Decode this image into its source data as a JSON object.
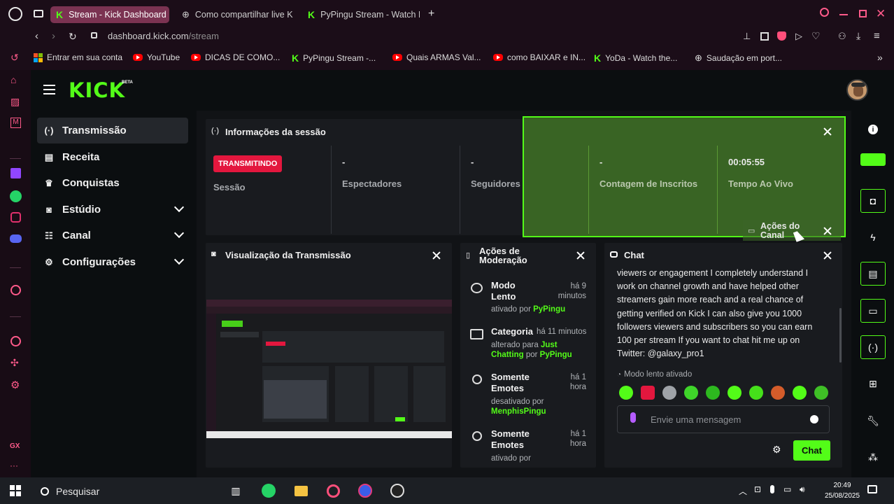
{
  "browser": {
    "tabs": [
      {
        "label": "Stream - Kick Dashboard",
        "active": true
      },
      {
        "label": "Como compartilhar live K",
        "active": false
      },
      {
        "label": "PyPingu Stream - Watch L",
        "active": false
      }
    ],
    "address_host": "dashboard.kick.com",
    "address_path": "/stream",
    "bookmarks": [
      {
        "label": "Entrar em sua conta"
      },
      {
        "label": "YouTube"
      },
      {
        "label": "DICAS DE COMO..."
      },
      {
        "label": "PyPingu Stream -..."
      },
      {
        "label": "Quais ARMAS Val..."
      },
      {
        "label": "como BAIXAR e IN..."
      },
      {
        "label": "YoDa - Watch the..."
      },
      {
        "label": "Saudação em port..."
      }
    ],
    "gx_label": "GX"
  },
  "kick": {
    "logo": "KICK",
    "logo_badge": "BETA"
  },
  "nav": [
    {
      "label": "Transmissão",
      "icon": "broadcast-icon",
      "active": true,
      "expandable": false
    },
    {
      "label": "Receita",
      "icon": "chart-icon",
      "active": false,
      "expandable": false
    },
    {
      "label": "Conquistas",
      "icon": "trophy-icon",
      "active": false,
      "expandable": false
    },
    {
      "label": "Estúdio",
      "icon": "studio-icon",
      "active": false,
      "expandable": true
    },
    {
      "label": "Canal",
      "icon": "users-icon",
      "active": false,
      "expandable": true
    },
    {
      "label": "Configurações",
      "icon": "gear-icon",
      "active": false,
      "expandable": true
    }
  ],
  "session": {
    "title": "Informações da sessão",
    "status_badge": "TRANSMITINDO",
    "stats": [
      {
        "value": "",
        "label": "Sessão"
      },
      {
        "value": "-",
        "label": "Espectadores"
      },
      {
        "value": "-",
        "label": "Seguidores"
      },
      {
        "value": "-",
        "label": "Contagem de Inscritos"
      },
      {
        "value": "00:05:55",
        "label": "Tempo Ao Vivo"
      }
    ]
  },
  "channel_actions": {
    "title_line1": "Ações do",
    "title_line2": "Canal"
  },
  "preview": {
    "title": "Visualização da Transmissão"
  },
  "moderation": {
    "title_line1": "Ações de",
    "title_line2": "Moderação",
    "entries": [
      {
        "title1": "Modo",
        "title2": "Lento",
        "time1": "há 9",
        "time2": "minutos",
        "action": "ativado por",
        "user": "PyPingu"
      },
      {
        "title1": "Categoria",
        "time_inline": "há 11 minutos",
        "action": "alterado para",
        "value1": "Just",
        "value2": "Chatting",
        "by": "por",
        "user": "PyPingu"
      },
      {
        "title1": "Somente",
        "title2": "Emotes",
        "time1": "há 1",
        "time2": "hora",
        "action": "desativado por",
        "user": "MenphisPingu"
      },
      {
        "title1": "Somente",
        "title2": "Emotes",
        "time1": "há 1",
        "time2": "hora",
        "action": "ativado por"
      }
    ]
  },
  "chat": {
    "title": "Chat",
    "message_lines": [
      "viewers or engagement I completely understand I",
      "work on channel growth and have helped other",
      "streamers gain more reach and a real chance of",
      "getting verified on Kick I can also give you 1000",
      "followers viewers and subscribers so you can earn",
      "100 per stream If you want to chat hit me up on",
      "Twitter: @galaxy_pro1"
    ],
    "slow_mode_notice": "Modo lento ativado",
    "input_placeholder": "Envie uma mensagem",
    "send_label": "Chat"
  },
  "taskbar": {
    "search_label": "Pesquisar",
    "time": "20:49",
    "date": "25/08/2025"
  },
  "colors": {
    "kick_green": "#53fc18",
    "live_red": "#e3173e",
    "active_tab": "#7b3352",
    "highlight_panel": "#3d6b1f"
  }
}
